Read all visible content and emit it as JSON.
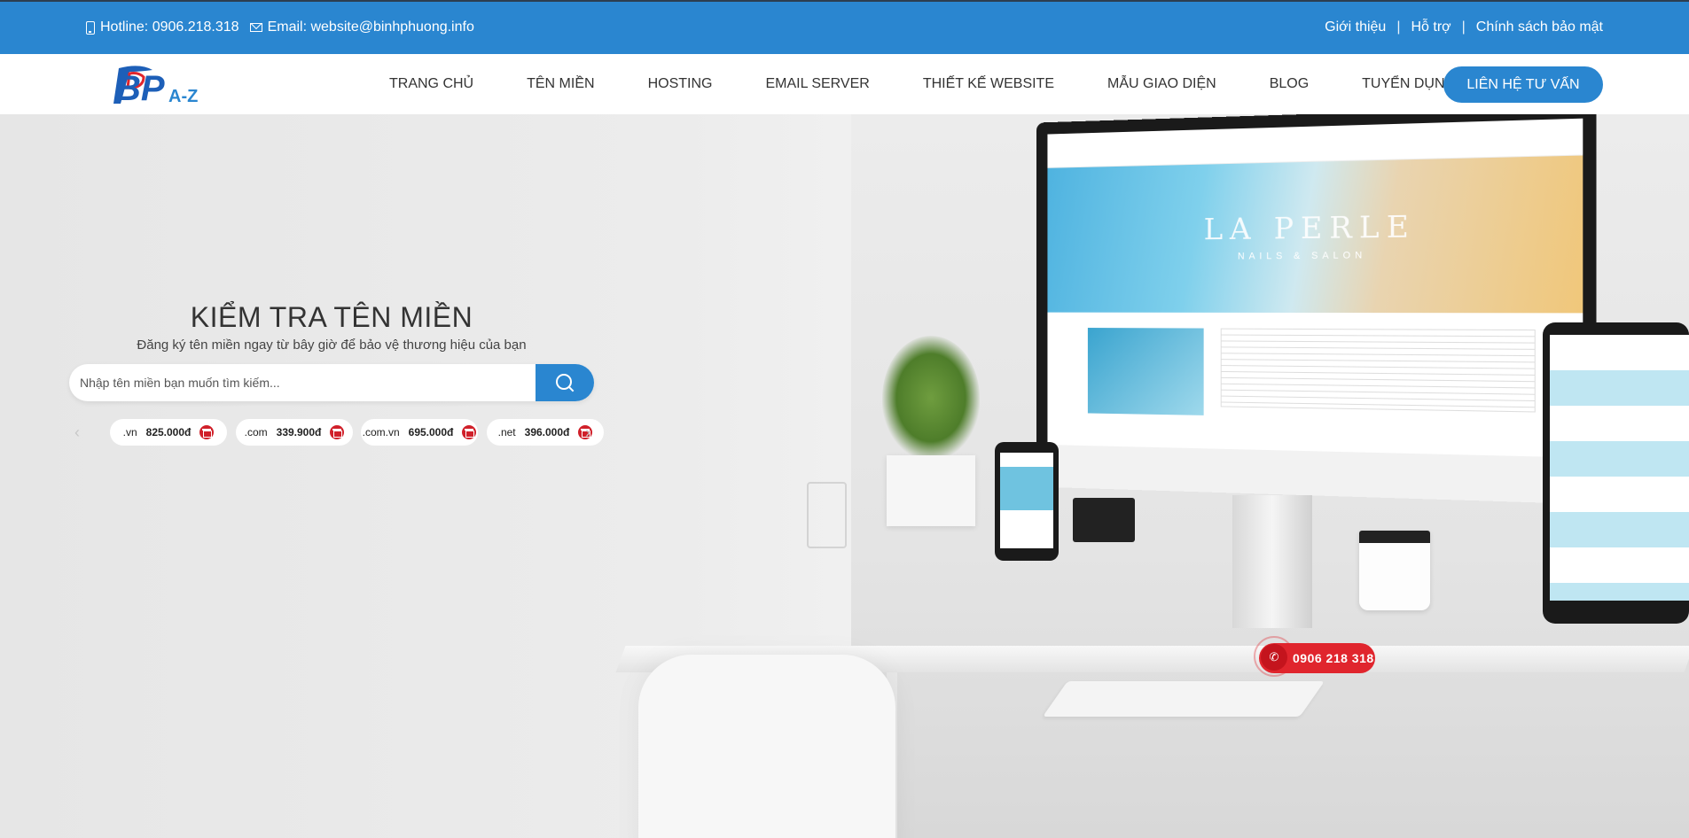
{
  "topbar": {
    "hotline": "Hotline: 0906.218.318",
    "email": "Email: website@binhphuong.info",
    "links": [
      "Giới thiệu",
      "Hỗ trợ",
      "Chính sách bảo mật"
    ]
  },
  "logo": {
    "text_main": "BP",
    "text_sub": "A-Z"
  },
  "nav": {
    "items": [
      "TRANG CHỦ",
      "TÊN MIỀN",
      "HOSTING",
      "EMAIL SERVER",
      "THIẾT KẾ WEBSITE",
      "MẪU GIAO DIỆN",
      "BLOG",
      "TUYỂN DỤNG"
    ],
    "cta": "LIÊN HỆ TƯ VẤN"
  },
  "hero": {
    "title": "KIỂM TRA TÊN MIỀN",
    "subtitle": "Đăng ký tên miền ngay từ bây giờ để bảo vệ thương hiệu của bạn",
    "search_placeholder": "Nhập tên miền bạn muốn tìm kiếm...",
    "mockup_brand": "LA PERLE",
    "mockup_tagline": "NAILS & SALON"
  },
  "tlds": [
    {
      "ext": ".vn",
      "price": "825.000đ"
    },
    {
      "ext": ".com",
      "price": "339.900đ"
    },
    {
      "ext": ".com.vn",
      "price": "695.000đ"
    },
    {
      "ext": ".net",
      "price": "396.000đ"
    }
  ],
  "float_call": {
    "phone": "0906 218 318"
  },
  "colors": {
    "primary": "#2a86d0",
    "call": "#e0252d",
    "gift": "#d0202a"
  },
  "icons": [
    "phone-icon",
    "mail-icon",
    "search-icon",
    "gift-icon",
    "call-icon",
    "chevron-left-icon",
    "chevron-right-icon"
  ]
}
